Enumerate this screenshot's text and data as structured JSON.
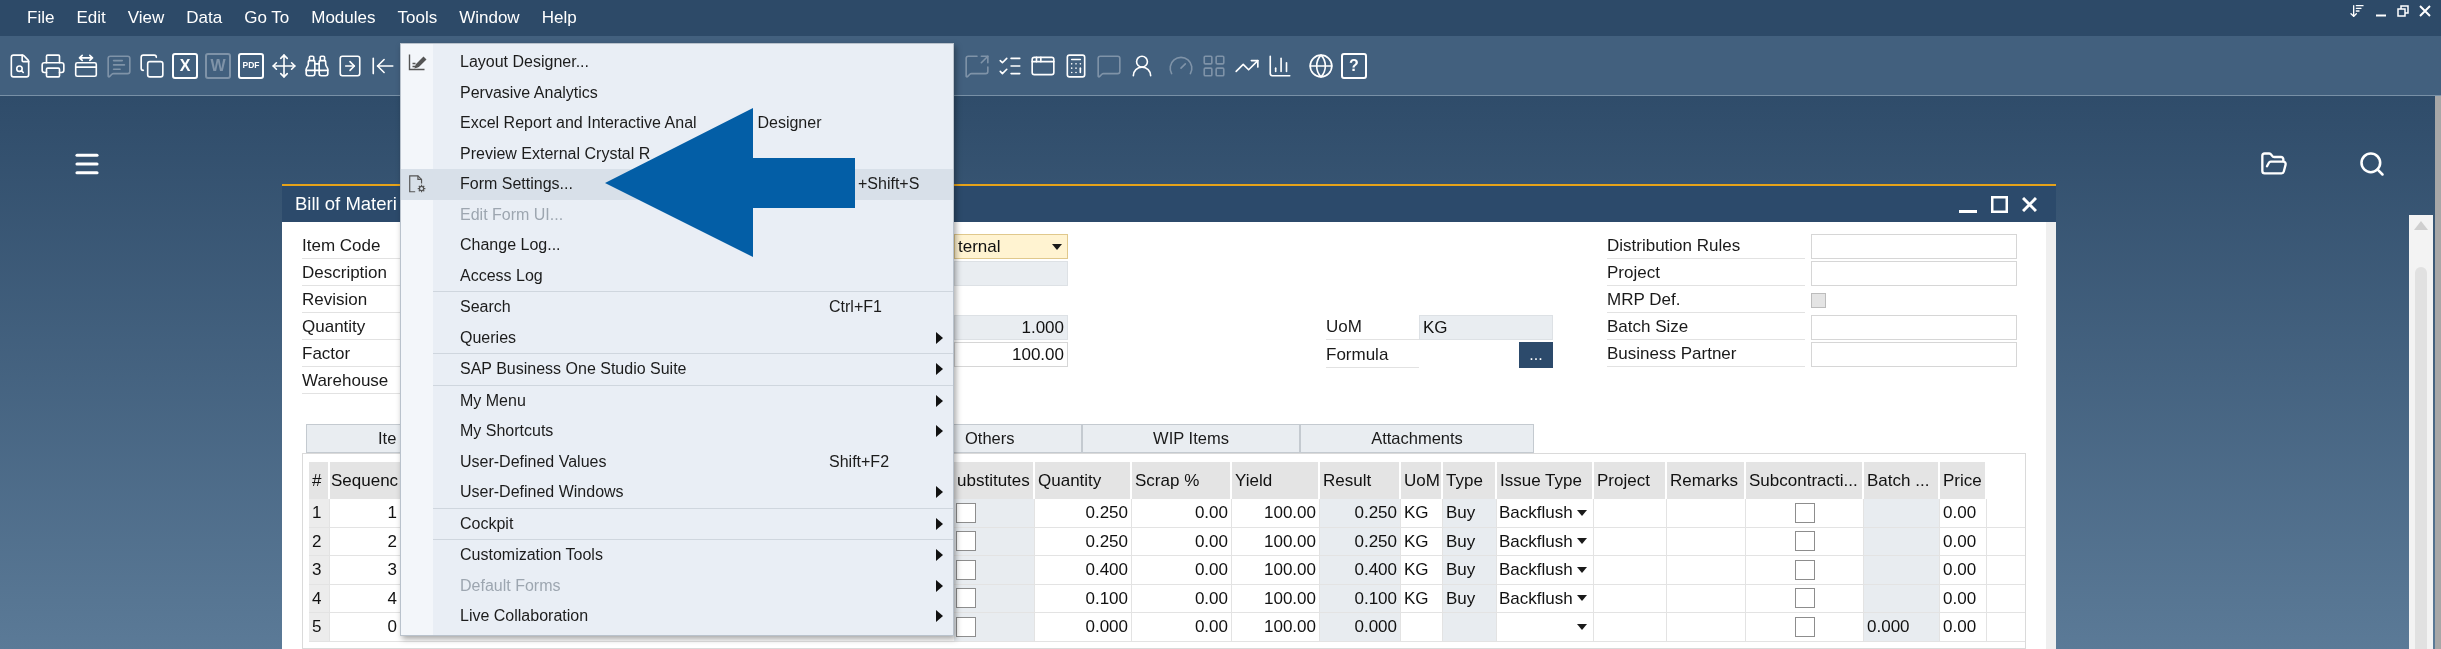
{
  "menu_bar": [
    "File",
    "Edit",
    "View",
    "Data",
    "Go To",
    "Modules",
    "Tools",
    "Window",
    "Help"
  ],
  "toolbar": {
    "left": [
      {
        "disabled": false
      },
      {
        "disabled": false
      },
      {
        "disabled": false
      },
      {
        "disabled": true
      },
      {
        "disabled": false
      },
      {
        "text": "X",
        "disabled": false
      },
      {
        "text": "W",
        "disabled": true
      },
      {
        "text": "PDF",
        "disabled": false
      },
      {
        "disabled": false
      },
      {
        "disabled": false
      },
      {
        "disabled": false
      },
      {
        "disabled": false
      }
    ],
    "right": [
      {
        "disabled": true
      },
      {
        "disabled": false
      },
      {
        "disabled": false
      },
      {
        "disabled": false
      },
      {
        "disabled": true
      },
      {
        "disabled": false
      },
      {
        "disabled": true
      },
      {
        "disabled": true
      },
      {
        "disabled": false
      },
      {
        "disabled": false
      },
      {
        "disabled": false
      },
      {
        "text": "?",
        "disabled": false
      }
    ]
  },
  "form_window": {
    "title": "Bill of Materi",
    "left_labels": [
      "Item Code",
      "Description",
      "Revision",
      "Quantity",
      "Factor",
      "Warehouse"
    ],
    "column_2_fields": [
      {
        "kind": "dropdown",
        "value": "ternal",
        "focused": true
      },
      {
        "kind": "text",
        "readonly": true,
        "focused": false
      },
      {
        "kind": "blank"
      },
      {
        "kind": "number",
        "readonly": true,
        "focused": false,
        "value": "1.000"
      },
      {
        "kind": "number",
        "readonly": false,
        "focused": false,
        "value": "100.00"
      }
    ],
    "middle_rows": [
      {
        "label": "UoM",
        "field": {
          "kind": "text",
          "readonly": true,
          "focused": false,
          "value": "KG"
        }
      },
      {
        "label": "Formula",
        "field": {
          "kind": "button",
          "text": "..."
        }
      }
    ],
    "right_rows": [
      {
        "label": "Distribution Rules",
        "field": {
          "kind": "text",
          "readonly": false,
          "focused": false
        }
      },
      {
        "label": "Project",
        "field": {
          "kind": "text",
          "readonly": false,
          "focused": false
        }
      },
      {
        "label": "MRP Def.",
        "field": {
          "kind": "checkbox",
          "checked": false,
          "disabled": true
        }
      },
      {
        "label": "Batch Size",
        "field": {
          "kind": "text",
          "readonly": false,
          "focused": false
        }
      },
      {
        "label": "Business Partner",
        "field": {
          "kind": "text",
          "readonly": false,
          "focused": false
        }
      }
    ],
    "tabs": [
      {
        "label": "Ite"
      },
      {
        "label": "Others"
      },
      {
        "label": "WIP Items"
      },
      {
        "label": "Attachments"
      }
    ],
    "table": {
      "left_columns": [
        {
          "label": "#",
          "kind": "index"
        },
        {
          "label": "Sequenc",
          "kind": "number"
        }
      ],
      "right_columns": [
        {
          "label": "ubstitutes",
          "kind": "checkbox",
          "readonly": true
        },
        {
          "label": "Quantity",
          "kind": "number",
          "readonly": false
        },
        {
          "label": "Scrap %",
          "kind": "number",
          "readonly": false
        },
        {
          "label": "Yield",
          "kind": "number",
          "readonly": false
        },
        {
          "label": "Result",
          "kind": "number",
          "readonly": true
        },
        {
          "label": "UoM",
          "kind": "text",
          "readonly": false
        },
        {
          "label": "Type",
          "kind": "text",
          "readonly": true
        },
        {
          "label": "Issue Type",
          "kind": "dropdown",
          "readonly": false
        },
        {
          "label": "Project",
          "kind": "text",
          "readonly": false
        },
        {
          "label": "Remarks",
          "kind": "text",
          "readonly": false
        },
        {
          "label": "Subcontracti...",
          "kind": "checkbox",
          "readonly": false
        },
        {
          "label": "Batch ...",
          "kind": "text",
          "readonly": true
        },
        {
          "label": "Price",
          "kind": "text",
          "readonly": false
        }
      ],
      "rows": [
        {
          "row_number": "1",
          "column_2": "1",
          "column_3": {
            "checked": false
          },
          "quantity": "0.250",
          "scrap": "0.00",
          "yield": "100.00",
          "result": "0.250",
          "uom": "KG",
          "type": "Buy",
          "issue_type": "Backflush",
          "subcontracting": {
            "checked": false
          },
          "price": "0.00"
        },
        {
          "row_number": "2",
          "column_2": "2",
          "column_3": {
            "checked": false
          },
          "quantity": "0.250",
          "scrap": "0.00",
          "yield": "100.00",
          "result": "0.250",
          "uom": "KG",
          "type": "Buy",
          "issue_type": "Backflush",
          "subcontracting": {
            "checked": false
          },
          "price": "0.00"
        },
        {
          "row_number": "3",
          "column_2": "3",
          "column_3": {
            "checked": false
          },
          "quantity": "0.400",
          "scrap": "0.00",
          "yield": "100.00",
          "result": "0.400",
          "uom": "KG",
          "type": "Buy",
          "issue_type": "Backflush",
          "subcontracting": {
            "checked": false
          },
          "price": "0.00"
        },
        {
          "row_number": "4",
          "column_2": "4",
          "column_3": {
            "checked": false
          },
          "quantity": "0.100",
          "scrap": "0.00",
          "yield": "100.00",
          "result": "0.100",
          "uom": "KG",
          "type": "Buy",
          "issue_type": "Backflush",
          "subcontracting": {
            "checked": false
          },
          "price": "0.00"
        },
        {
          "row_number": "5",
          "column_2": "0",
          "column_3": {
            "checked": false
          },
          "quantity": "0.000",
          "scrap": "0.00",
          "yield": "100.00",
          "result": "0.000",
          "subcontracting": {
            "checked": false
          },
          "batch": "0.000",
          "price": "0.00"
        }
      ]
    }
  },
  "tools_menu": {
    "items": [
      {
        "kind": "item",
        "label": "Layout Designer...",
        "selected": false,
        "disabled": false,
        "submenu": false
      },
      {
        "kind": "item",
        "label": "Pervasive Analytics",
        "selected": false,
        "disabled": false,
        "submenu": false
      },
      {
        "kind": "item",
        "label": "Excel Report and Interactive Anal",
        "label_tail": "Designer",
        "selected": false,
        "disabled": false,
        "submenu": false
      },
      {
        "kind": "item",
        "label": "Preview External Crystal R",
        "selected": false,
        "disabled": false,
        "submenu": false
      },
      {
        "kind": "item",
        "label": "Form Settings...",
        "shortcut": "+Shift+S",
        "selected": true,
        "disabled": false,
        "submenu": false
      },
      {
        "kind": "item",
        "label": "Edit Form UI...",
        "selected": false,
        "disabled": true,
        "submenu": false
      },
      {
        "kind": "item",
        "label": "Change Log...",
        "selected": false,
        "disabled": false,
        "submenu": false
      },
      {
        "kind": "item",
        "label": "Access Log",
        "selected": false,
        "disabled": false,
        "submenu": false
      },
      {
        "kind": "separator"
      },
      {
        "kind": "item",
        "label": "Search",
        "shortcut": "Ctrl+F1",
        "selected": false,
        "disabled": false,
        "submenu": false
      },
      {
        "kind": "item",
        "label": "Queries",
        "selected": false,
        "disabled": false,
        "submenu": true
      },
      {
        "kind": "separator"
      },
      {
        "kind": "item",
        "label": "SAP Business One Studio Suite",
        "selected": false,
        "disabled": false,
        "submenu": true
      },
      {
        "kind": "separator"
      },
      {
        "kind": "item",
        "label": "My Menu",
        "selected": false,
        "disabled": false,
        "submenu": true
      },
      {
        "kind": "item",
        "label": "My Shortcuts",
        "selected": false,
        "disabled": false,
        "submenu": true
      },
      {
        "kind": "item",
        "label": "User-Defined Values",
        "shortcut": "Shift+F2",
        "selected": false,
        "disabled": false,
        "submenu": false
      },
      {
        "kind": "item",
        "label": "User-Defined Windows",
        "selected": false,
        "disabled": false,
        "submenu": true
      },
      {
        "kind": "separator"
      },
      {
        "kind": "item",
        "label": "Cockpit",
        "selected": false,
        "disabled": false,
        "submenu": true
      },
      {
        "kind": "separator"
      },
      {
        "kind": "item",
        "label": "Customization Tools",
        "selected": false,
        "disabled": false,
        "submenu": true
      },
      {
        "kind": "item",
        "label": "Default Forms",
        "selected": false,
        "disabled": true,
        "submenu": true
      },
      {
        "kind": "item",
        "label": "Live Collaboration",
        "selected": false,
        "disabled": false,
        "submenu": true
      }
    ]
  }
}
